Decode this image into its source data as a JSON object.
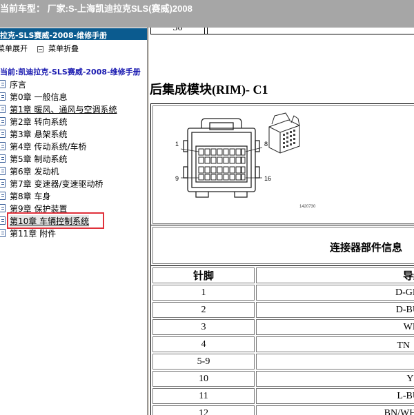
{
  "header": {
    "title": "当前车型：  厂家:S-上海凯迪拉克SLS(赛威)2008"
  },
  "sidebar": {
    "manual_title": "拉克-SLS赛威-2008-维修手册",
    "actions": {
      "expand_label": "菜单展开",
      "collapse_label": "菜单折叠"
    },
    "current_path": "当前:凯迪拉克-SLS赛威-2008-维修手册",
    "items": [
      {
        "label": "序言"
      },
      {
        "label": "第0章 一般信息"
      },
      {
        "label": "第1章 暖风、通风与空调系统"
      },
      {
        "label": "第2章 转向系统"
      },
      {
        "label": "第3章 悬架系统"
      },
      {
        "label": "第4章 传动系统/车桥"
      },
      {
        "label": "第5章 制动系统"
      },
      {
        "label": "第6章 发动机"
      },
      {
        "label": "第7章 变速器/变速驱动桥"
      },
      {
        "label": "第8章 车身"
      },
      {
        "label": "第9章 保护装置"
      },
      {
        "label": "第10章 车辆控制系统"
      },
      {
        "label": "第11章 附件"
      }
    ],
    "selected_index": 11
  },
  "content": {
    "prev_row_number": "30",
    "section_title": "后集成模块(RIM)- C1",
    "diagram": {
      "pin_label_1": "1",
      "pin_label_8": "8",
      "pin_label_9": "9",
      "pin_label_16": "16",
      "figure_number": "1420730"
    },
    "info_title": "连接器部件信息",
    "table": {
      "headers": [
        "针脚",
        "导线"
      ],
      "header_visible": [
        "针脚",
        "导约"
      ],
      "rows": [
        {
          "pin": "1",
          "wire": "D-GN"
        },
        {
          "pin": "2",
          "wire": "D-BU"
        },
        {
          "pin": "3",
          "wire": "WH"
        },
        {
          "pin": "4",
          "wire": "TN（"
        },
        {
          "pin": "5-9",
          "wire": ""
        },
        {
          "pin": "10",
          "wire": "YE"
        },
        {
          "pin": "11",
          "wire": "L-BU"
        },
        {
          "pin": "12",
          "wire": "BN/WH("
        }
      ]
    }
  }
}
